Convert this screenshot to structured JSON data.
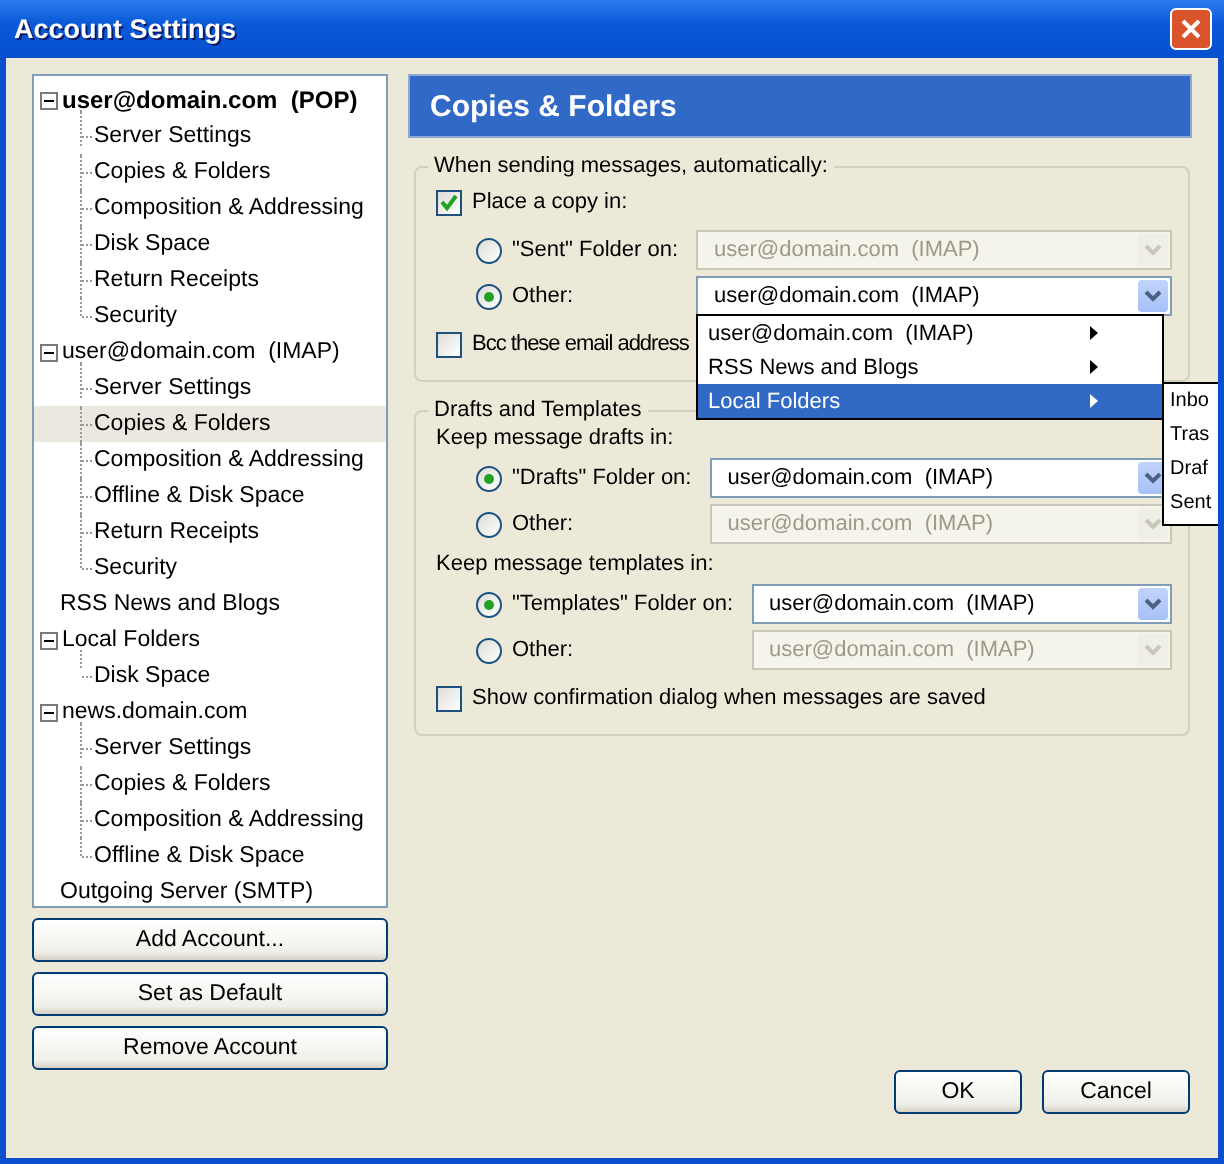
{
  "window": {
    "title": "Account Settings"
  },
  "tree": [
    {
      "label": "user@domain.com  (POP)",
      "bold": true,
      "expanded": true,
      "selected": false,
      "children": [
        {
          "label": "Server Settings",
          "selected": false
        },
        {
          "label": "Copies & Folders",
          "selected": false
        },
        {
          "label": "Composition & Addressing",
          "selected": false
        },
        {
          "label": "Disk Space",
          "selected": false
        },
        {
          "label": "Return Receipts",
          "selected": false
        },
        {
          "label": "Security",
          "selected": false
        }
      ]
    },
    {
      "label": "user@domain.com  (IMAP)",
      "bold": false,
      "expanded": true,
      "selected": false,
      "children": [
        {
          "label": "Server Settings",
          "selected": false
        },
        {
          "label": "Copies & Folders",
          "selected": true
        },
        {
          "label": "Composition & Addressing",
          "selected": false
        },
        {
          "label": "Offline & Disk Space",
          "selected": false
        },
        {
          "label": "Return Receipts",
          "selected": false
        },
        {
          "label": "Security",
          "selected": false
        }
      ]
    },
    {
      "label": "RSS News and Blogs",
      "bold": false,
      "selected": false
    },
    {
      "label": "Local Folders",
      "bold": false,
      "expanded": true,
      "selected": false,
      "children": [
        {
          "label": "Disk Space",
          "selected": false
        }
      ]
    },
    {
      "label": "news.domain.com",
      "bold": false,
      "expanded": true,
      "selected": false,
      "children": [
        {
          "label": "Server Settings",
          "selected": false
        },
        {
          "label": "Copies & Folders",
          "selected": false
        },
        {
          "label": "Composition & Addressing",
          "selected": false
        },
        {
          "label": "Offline & Disk Space",
          "selected": false
        }
      ]
    },
    {
      "label": "Outgoing Server (SMTP)",
      "bold": false,
      "selected": false
    }
  ],
  "account_buttons": [
    "Add Account...",
    "Set as Default",
    "Remove Account"
  ],
  "panel_title": "Copies & Folders",
  "sending": {
    "legend": "When sending messages, automatically:",
    "place_copy": {
      "label": "Place a copy in:",
      "checked": true
    },
    "options": [
      {
        "label": "\"Sent\" Folder on:",
        "selected": false,
        "value": "user@domain.com  (IMAP)"
      },
      {
        "label": "Other:",
        "selected": true,
        "value": "user@domain.com  (IMAP)"
      }
    ],
    "bcc": {
      "label": "Bcc these email address",
      "checked": false
    }
  },
  "menu": {
    "items": [
      {
        "label": "user@domain.com  (IMAP)",
        "selected": false
      },
      {
        "label": "RSS News and Blogs",
        "selected": false
      },
      {
        "label": "Local Folders",
        "selected": true
      }
    ],
    "submenu": [
      "Inbo",
      "Tras",
      "Draf",
      "Sent"
    ]
  },
  "drafts": {
    "legend": "Drafts and Templates",
    "drafts_heading": "Keep message drafts in:",
    "drafts_options": [
      {
        "label": "\"Drafts\" Folder on:",
        "selected": true,
        "value": "user@domain.com  (IMAP)"
      },
      {
        "label": "Other:",
        "selected": false,
        "value": "user@domain.com  (IMAP)"
      }
    ],
    "templates_heading": "Keep message templates in:",
    "templates_options": [
      {
        "label": "\"Templates\" Folder on:",
        "selected": true,
        "value": "user@domain.com  (IMAP)"
      },
      {
        "label": "Other:",
        "selected": false,
        "value": "user@domain.com  (IMAP)"
      }
    ],
    "confirm": {
      "label": "Show confirmation dialog when messages are saved",
      "checked": false
    }
  },
  "footer_buttons": [
    "OK",
    "Cancel"
  ]
}
